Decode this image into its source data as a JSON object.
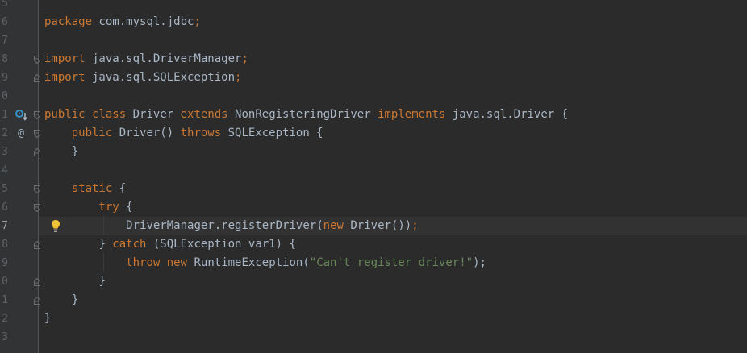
{
  "editor": {
    "line_numbers": [
      "5",
      "6",
      "7",
      "8",
      "9",
      "0",
      "1",
      "2",
      "3",
      "4",
      "5",
      "6",
      "7",
      "8",
      "9",
      "0",
      "1",
      "2",
      "3"
    ],
    "current_line_index": 12,
    "tokens": {
      "package": "package",
      "package_name": " com.mysql.jdbc",
      "semicolon": ";",
      "import": "import",
      "import1_name": " java.sql.DriverManager",
      "import2_name": " java.sql.SQLException",
      "public": "public",
      "class": "class",
      "class_name": " Driver ",
      "extends": "extends",
      "parent": " NonRegisteringDriver ",
      "implements": "implements",
      "iface": " java.sql.Driver {",
      "ctor_public": "public",
      "ctor_sig": " Driver() ",
      "throws": "throws",
      "ctor_exc": " SQLException {",
      "close_brace": "}",
      "static": "static",
      "static_open": " {",
      "try": "try",
      "try_open": " {",
      "dm": "DriverManager.",
      "register": "registerDriver",
      "paren_open": "(",
      "new": "new",
      "new_driver": " Driver())",
      "catch_prefix": "} ",
      "catch": "catch",
      "catch_rest": " (SQLException var1) {",
      "throw": "throw",
      "throw_new": "new",
      "runtime": " RuntimeException(",
      "message": "\"Can't register driver!\"",
      "throw_end": ");"
    },
    "gutter_markers": {
      "implements_icon": "override-down-icon",
      "override_icon": "@",
      "bulb_icon": "lightbulb-icon"
    }
  }
}
